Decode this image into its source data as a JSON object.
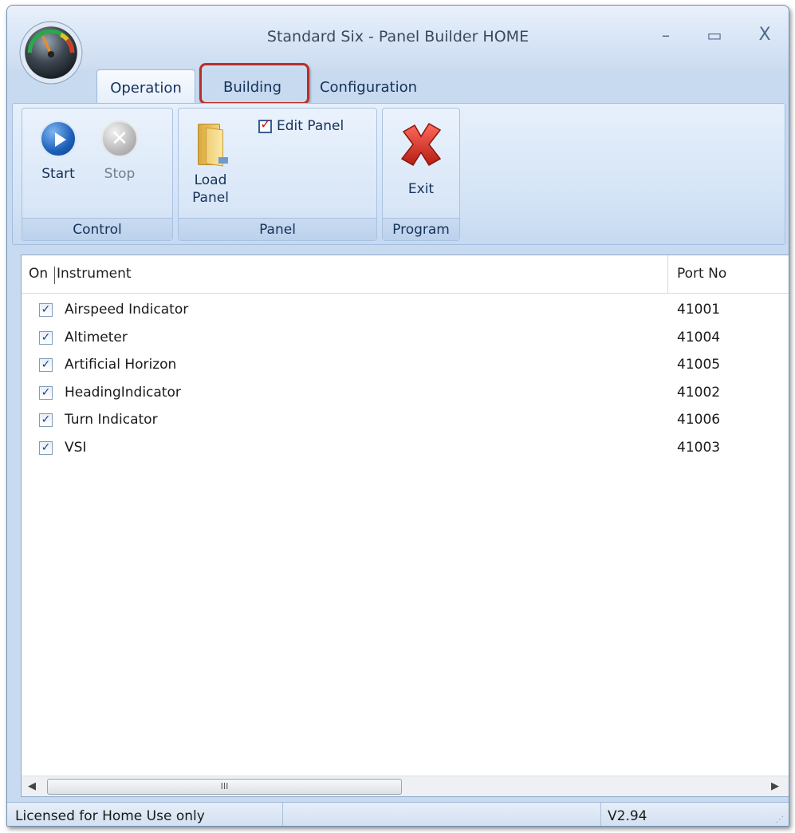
{
  "window": {
    "title": "Standard Six - Panel Builder HOME",
    "controls": {
      "minimize": "–",
      "maximize": "▭",
      "close": "X"
    }
  },
  "tabs": [
    {
      "label": "Operation",
      "active": true
    },
    {
      "label": "Building",
      "highlighted": true
    },
    {
      "label": "Configuration"
    }
  ],
  "ribbon": {
    "control": {
      "label": "Control",
      "start": "Start",
      "stop": "Stop"
    },
    "panel": {
      "label": "Panel",
      "load_line1": "Load",
      "load_line2": "Panel",
      "edit": "Edit Panel"
    },
    "program": {
      "label": "Program",
      "exit": "Exit"
    }
  },
  "list": {
    "columns": {
      "on": "On",
      "instrument": "Instrument",
      "port": "Port No"
    },
    "rows": [
      {
        "checked": true,
        "name": "Airspeed Indicator",
        "port": "41001"
      },
      {
        "checked": true,
        "name": "Altimeter",
        "port": "41004"
      },
      {
        "checked": true,
        "name": "Artificial Horizon",
        "port": "41005"
      },
      {
        "checked": true,
        "name": "HeadingIndicator",
        "port": "41002"
      },
      {
        "checked": true,
        "name": "Turn Indicator",
        "port": "41006"
      },
      {
        "checked": true,
        "name": "VSI",
        "port": "41003"
      }
    ],
    "scroll_grip": "III"
  },
  "status": {
    "license": "Licensed for Home Use only",
    "version": "V2.94"
  },
  "colors": {
    "highlight_border": "#b5302a",
    "window_frame": "#c8daf0",
    "ribbon_text": "#15325a"
  }
}
